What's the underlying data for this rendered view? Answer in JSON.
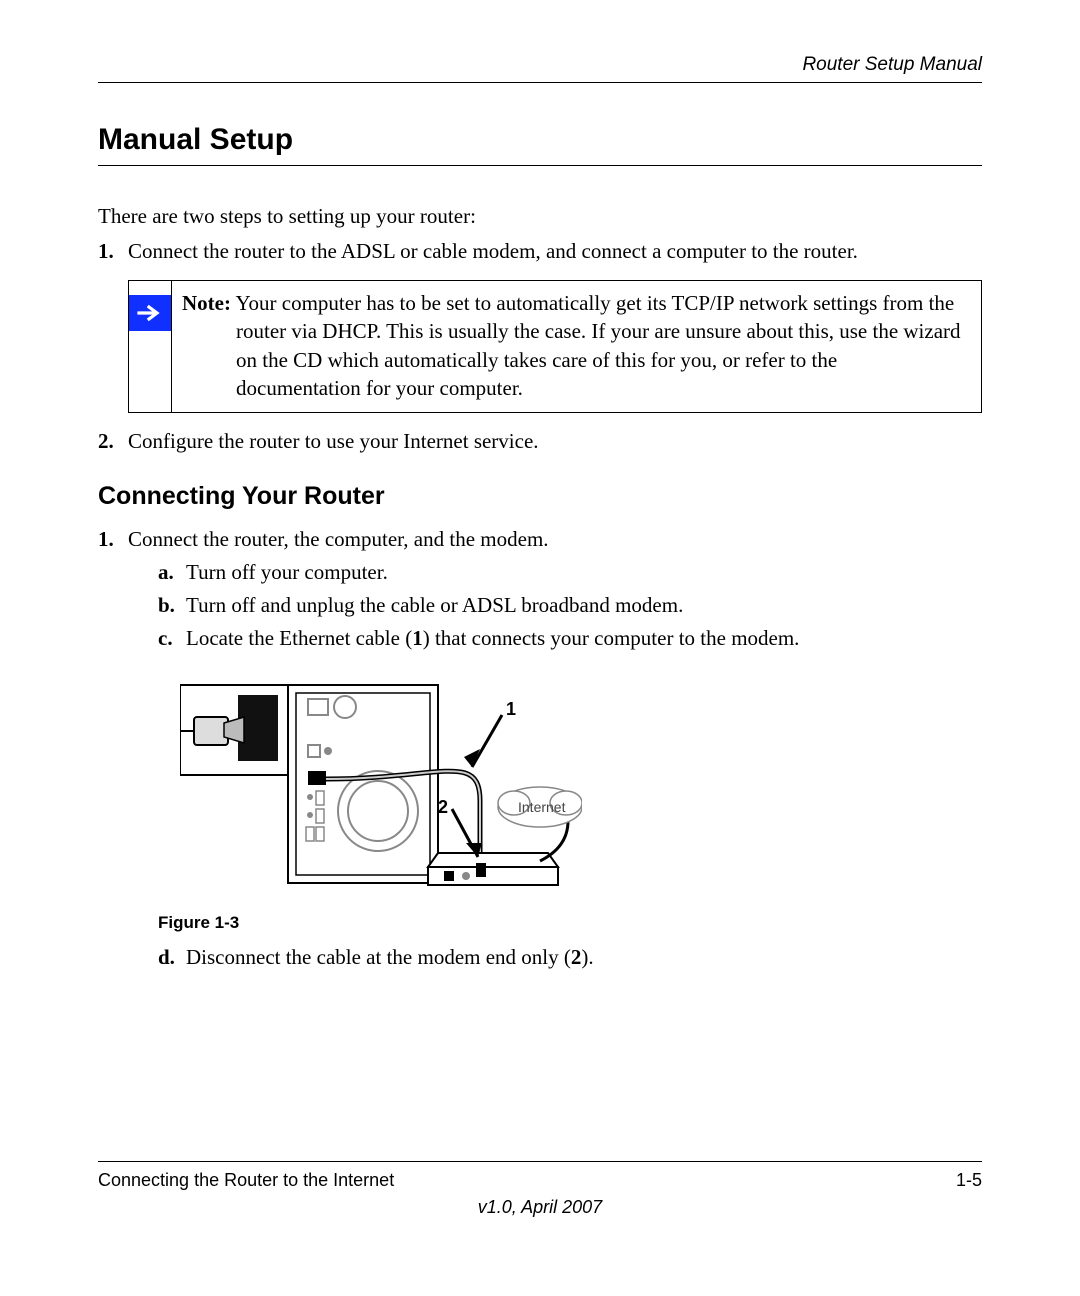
{
  "header": {
    "doc_title": "Router Setup Manual"
  },
  "section": {
    "h1": "Manual Setup",
    "intro": "There are two steps to setting up your router:",
    "step1_marker": "1.",
    "step1_text": "Connect the router to the ADSL or cable modem, and connect a computer to the router.",
    "note_label": "Note:",
    "note_body": " Your computer has to be set to automatically get its TCP/IP network settings from the router via DHCP. This is usually the case. If your are unsure about this, use the wizard on the CD which automatically takes care of this for you, or refer to the documentation for your computer.",
    "step2_marker": "2.",
    "step2_text": "Configure the router to use your Internet service."
  },
  "connecting": {
    "h2": "Connecting Your Router",
    "c1_marker": "1.",
    "c1_text": "Connect the router, the computer, and the modem.",
    "a_marker": "a.",
    "a_text": "Turn off your computer.",
    "b_marker": "b.",
    "b_text": "Turn off and unplug the cable or ADSL broadband modem.",
    "c_marker": "c.",
    "c_text_pre": "Locate the Ethernet cable (",
    "c_bold": "1",
    "c_text_post": ") that connects your computer to the modem.",
    "figure": {
      "caption": "Figure 1-3",
      "label1": "1",
      "label2": "2",
      "internet_label": "Internet"
    },
    "d_marker": "d.",
    "d_text_pre": "Disconnect the cable at the modem end only (",
    "d_bold": "2",
    "d_text_post": ")."
  },
  "footer": {
    "chapter": "Connecting the Router to the Internet",
    "page": "1-5",
    "version": "v1.0, April 2007"
  }
}
